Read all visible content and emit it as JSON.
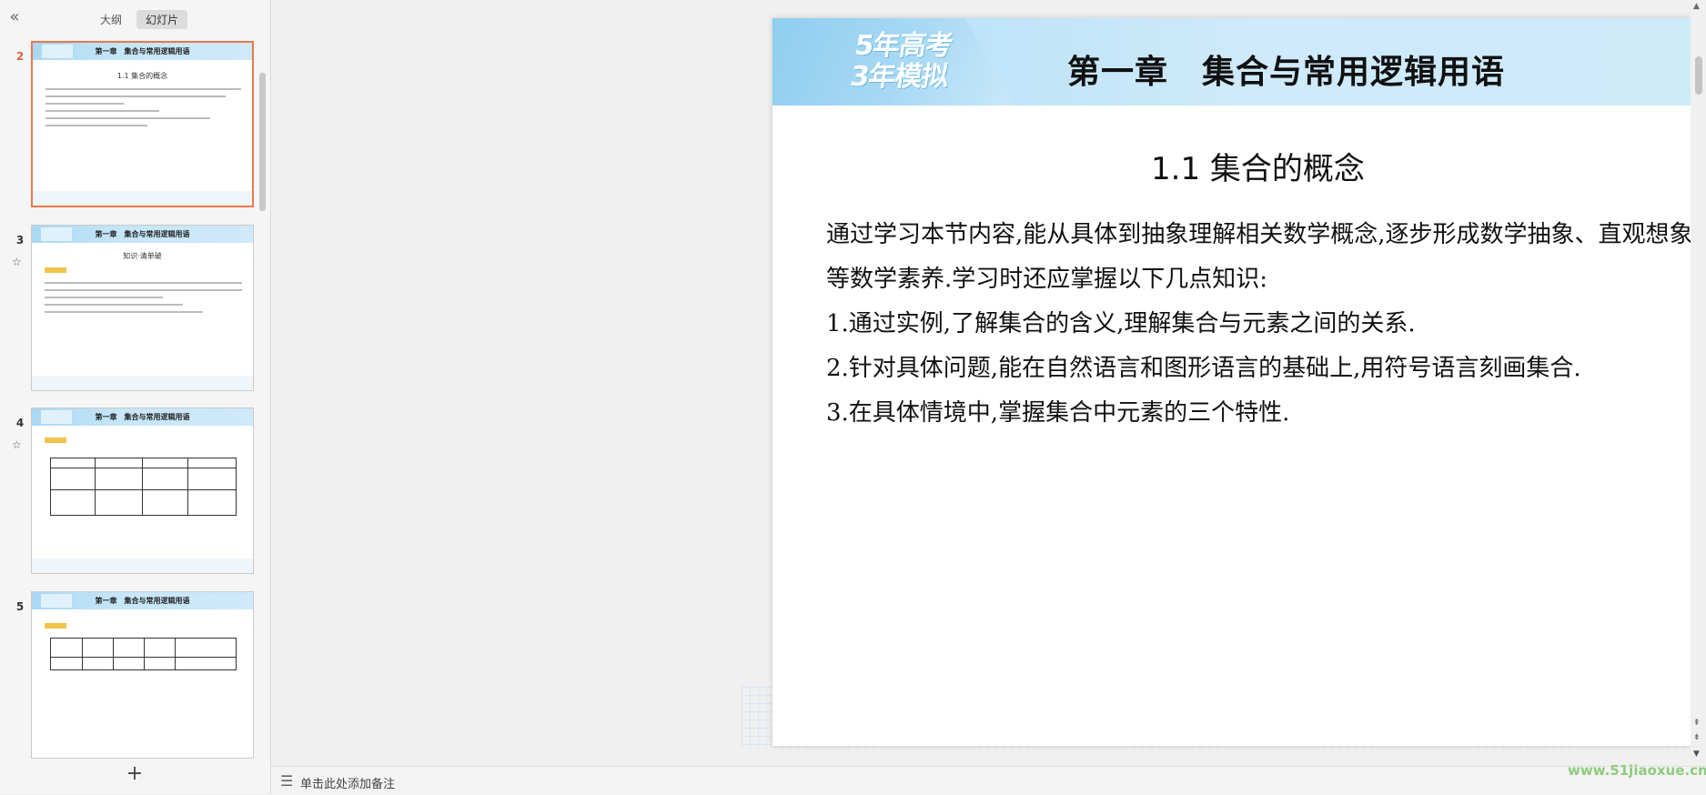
{
  "left_panel": {
    "collapse_icon": "double-chevron-left-icon",
    "tabs": [
      {
        "label": "大纲",
        "active": false
      },
      {
        "label": "幻灯片",
        "active": true
      }
    ],
    "thumbnails": [
      {
        "number": "2",
        "title": "第一章　集合与常用逻辑用语",
        "subtitle": "1.1 集合的概念",
        "selected": true,
        "starred": false
      },
      {
        "number": "3",
        "title": "第一章　集合与常用逻辑用语",
        "subtitle": "知识·清单破",
        "selected": false,
        "starred": true
      },
      {
        "number": "4",
        "title": "第一章　集合与常用逻辑用语",
        "subtitle": "",
        "selected": false,
        "starred": true
      },
      {
        "number": "5",
        "title": "第一章　集合与常用逻辑用语",
        "subtitle": "",
        "selected": false,
        "starred": false
      }
    ],
    "add_slide_icon": "plus-icon"
  },
  "slide": {
    "logo": {
      "line1": "5年高考",
      "line2": "3年模拟"
    },
    "chapter_title": "第一章　集合与常用逻辑用语",
    "section_title": "1.1  集合的概念",
    "paragraphs": [
      "通过学习本节内容,能从具体到抽象理解相关数学概念,逐步形成数学抽象、直观想象等数学素养.学习时还应掌握以下几点知识:",
      "1.通过实例,了解集合的含义,理解集合与元素之间的关系.",
      "2.针对具体问题,能在自然语言和图形语言的基础上,用符号语言刻画集合.",
      "3.在具体情境中,掌握集合中元素的三个特性."
    ]
  },
  "notes_bar": {
    "icon": "notes-lines-icon",
    "placeholder": "单击此处添加备注"
  },
  "watermark": "www.51jiaoxue.cn",
  "colors": {
    "accent_selected": "#e8784f",
    "header_blue": "#b3def6",
    "watermark_green": "#8fcb7e"
  }
}
